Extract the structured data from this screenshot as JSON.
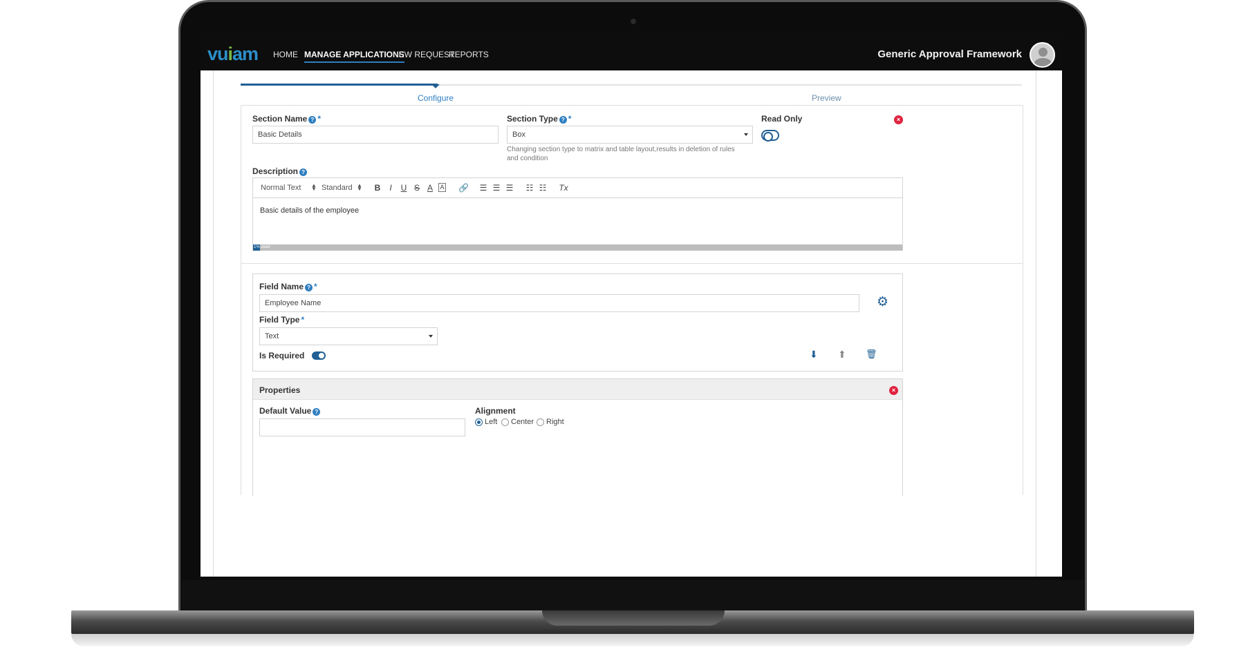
{
  "nav": {
    "items": [
      {
        "label": "HOME"
      },
      {
        "label": "MANAGE APPLICATIONS"
      },
      {
        "label": "NEW REQUEST"
      },
      {
        "label": "REPORTS"
      }
    ],
    "app_title": "Generic Approval Framework"
  },
  "logo": {
    "text_a": "vu",
    "text_m": "i",
    "text_b": "am"
  },
  "stepper": {
    "steps": [
      {
        "label": "Configure"
      },
      {
        "label": "Preview"
      }
    ]
  },
  "section": {
    "name_label": "Section Name",
    "name_value": "Basic Details",
    "type_label": "Section Type",
    "type_value": "Box",
    "type_hint": "Changing section type to matrix and table layout,results in deletion of rules and condition",
    "read_only_label": "Read Only",
    "description_label": "Description",
    "description_value": "Basic details of the employee",
    "usage_text": "1% used"
  },
  "toolbar": {
    "text_style": "Normal Text",
    "font": "Standard",
    "bold": "B",
    "italic": "I",
    "underline": "U",
    "strike": "S",
    "font_color": "A",
    "bg_color": "A",
    "clear": "Tx"
  },
  "field": {
    "name_label": "Field Name",
    "name_value": "Employee Name",
    "type_label": "Field Type",
    "type_value": "Text",
    "required_label": "Is Required"
  },
  "properties": {
    "title": "Properties",
    "default_value_label": "Default Value",
    "default_value": "",
    "alignment_label": "Alignment",
    "alignment_options": [
      {
        "label": "Left"
      },
      {
        "label": "Center"
      },
      {
        "label": "Right"
      }
    ]
  },
  "colors": {
    "accent": "#1f5f94",
    "danger": "#e0243f",
    "nav_bg": "#0d0d0d"
  }
}
